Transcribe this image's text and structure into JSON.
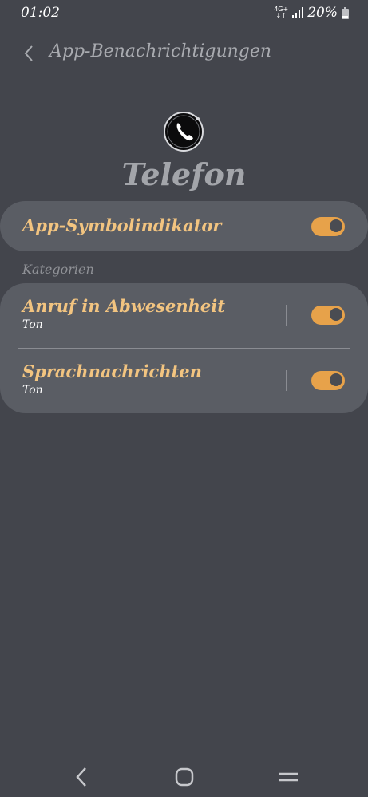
{
  "status_bar": {
    "time": "01:02",
    "network": "4G+",
    "battery": "20%"
  },
  "header": {
    "title": "App-Benachrichtigungen"
  },
  "app": {
    "name": "Telefon"
  },
  "badge_row": {
    "label": "App-Symbolindikator",
    "enabled": true
  },
  "categories": {
    "section_label": "Kategorien",
    "items": [
      {
        "label": "Anruf in Abwesenheit",
        "sub": "Ton",
        "enabled": true
      },
      {
        "label": "Sprachnachrichten",
        "sub": "Ton",
        "enabled": true
      }
    ]
  },
  "colors": {
    "background": "#43454c",
    "card": "#5a5d64",
    "accent": "#e7a24a",
    "label": "#f2c480"
  },
  "icons": {
    "back": "back-arrow-icon",
    "app": "phone-icon",
    "nav_back": "chevron-left-icon",
    "nav_home": "home-icon",
    "nav_recents": "recents-icon"
  }
}
